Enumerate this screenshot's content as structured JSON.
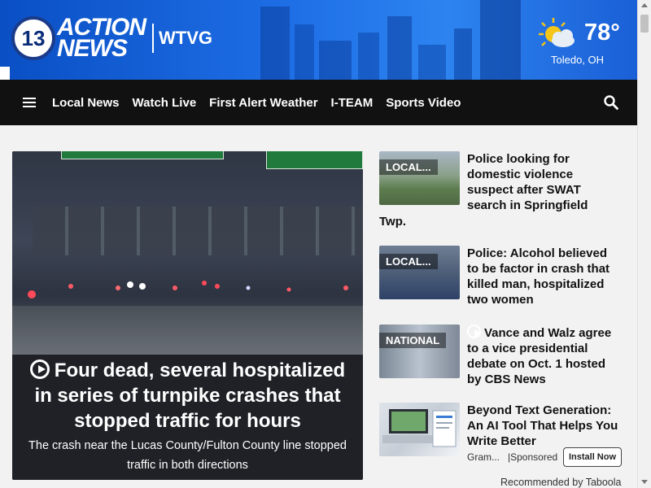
{
  "header": {
    "logo_number": "13",
    "logo_word1": "ACTION",
    "logo_word2": "NEWS",
    "call_sign": "WTVG",
    "weather": {
      "temperature": "78°",
      "location": "Toledo, OH",
      "icon": "partly-sunny-icon"
    }
  },
  "nav": {
    "items": [
      "Local News",
      "Watch Live",
      "First Alert Weather",
      "I-TEAM",
      "Sports Video"
    ]
  },
  "hero": {
    "title": "Four dead, several hospitalized in series of turnpike crashes that stopped traffic for hours",
    "subtitle": "The crash near the Lucas County/Fulton County line stopped traffic in both directions"
  },
  "stories": [
    {
      "tag": "LOCAL...",
      "title": "Police looking for domestic violence suspect after SWAT search in Springfield",
      "title_tail": "Twp."
    },
    {
      "tag": "LOCAL...",
      "title": "Police: Alcohol believed to be factor in crash that killed man, hospitalized two women"
    },
    {
      "tag": "NATIONAL",
      "title": "Vance and Walz agree to a vice presidential debate on Oct. 1 hosted by CBS News"
    }
  ],
  "sponsored": {
    "title": "Beyond Text Generation: An AI Tool That Helps You Write Better",
    "source": "Gram...",
    "label": "|Sponsored",
    "button": "Install Now",
    "footer": "Recommended by Taboola"
  },
  "colors": {
    "nav_bg": "#111111",
    "banner_blue": "#1e6ee6",
    "hero_bg": "#1f2127"
  }
}
